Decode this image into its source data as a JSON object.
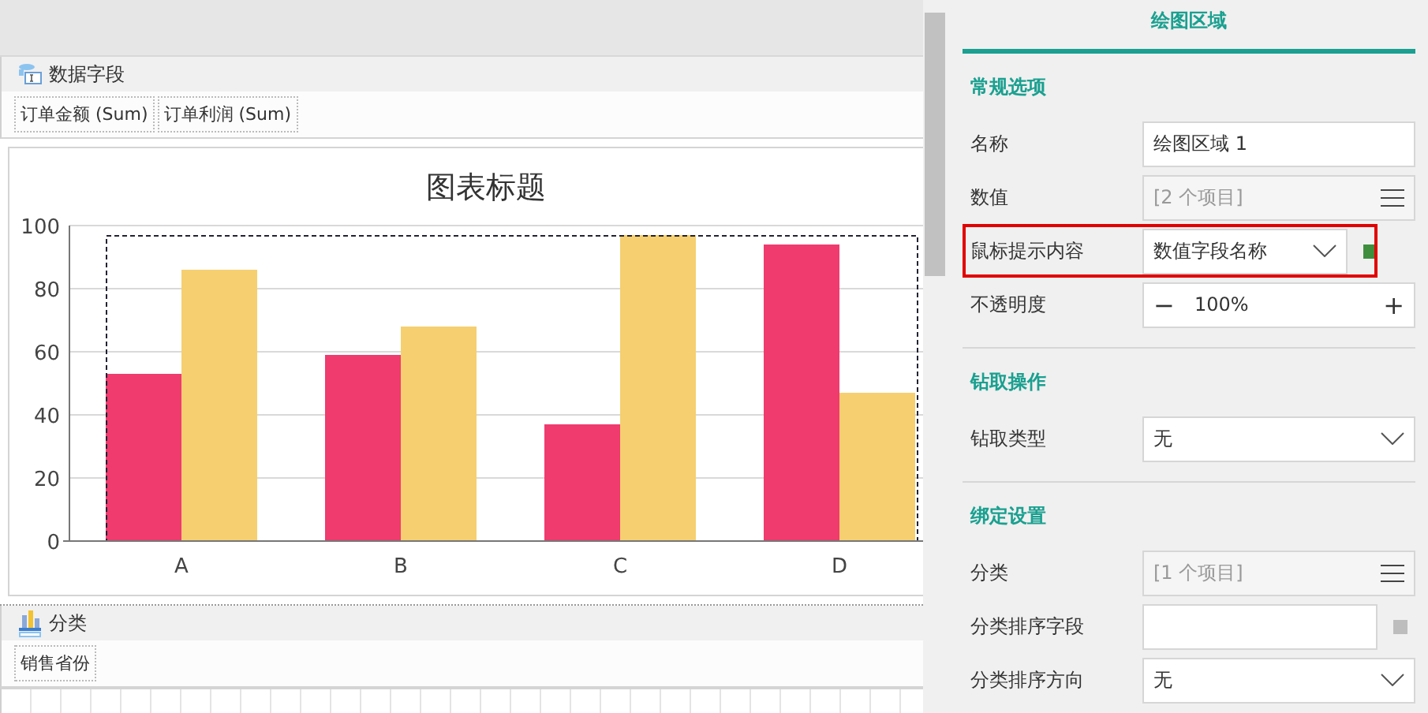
{
  "data_fields": {
    "title": "数据字段",
    "chips": [
      "订单金额 (Sum)",
      "订单利润 (Sum)"
    ]
  },
  "chart": {
    "title": "图表标题",
    "chart_data": {
      "type": "bar",
      "categories": [
        "A",
        "B",
        "C",
        "D"
      ],
      "series": [
        {
          "color": "#ef3b6e",
          "values": [
            53,
            59,
            37,
            94
          ]
        },
        {
          "color": "#f5cf70",
          "values": [
            86,
            68,
            97,
            47
          ]
        }
      ],
      "ylim": [
        0,
        100
      ],
      "grid": true,
      "yticks": [
        0,
        20,
        40,
        60,
        80,
        100
      ]
    }
  },
  "category_fields": {
    "title": "分类",
    "chips": [
      "销售省份"
    ]
  },
  "panel": {
    "tab": "绘图区域",
    "sections": [
      {
        "title": "常规选项",
        "rows": [
          {
            "label": "名称",
            "kind": "input",
            "value": "绘图区域 1"
          },
          {
            "label": "数值",
            "kind": "list",
            "placeholder": "[2 个项目]"
          },
          {
            "label": "鼠标提示内容",
            "kind": "select",
            "value": "数值字段名称",
            "highlighted": true,
            "color": "#3e8e3e"
          },
          {
            "label": "不透明度",
            "kind": "stepper",
            "minus": "−",
            "value": "100%",
            "plus": "+"
          }
        ]
      },
      {
        "title": "钻取操作",
        "rows": [
          {
            "label": "钻取类型",
            "kind": "select",
            "value": "无"
          }
        ]
      },
      {
        "title": "绑定设置",
        "rows": [
          {
            "label": "分类",
            "kind": "list",
            "placeholder": "[1 个项目]"
          },
          {
            "label": "分类排序字段",
            "kind": "input",
            "color": "#bdbdbd"
          },
          {
            "label": "分类排序方向",
            "kind": "select",
            "value": "无"
          }
        ]
      }
    ]
  }
}
